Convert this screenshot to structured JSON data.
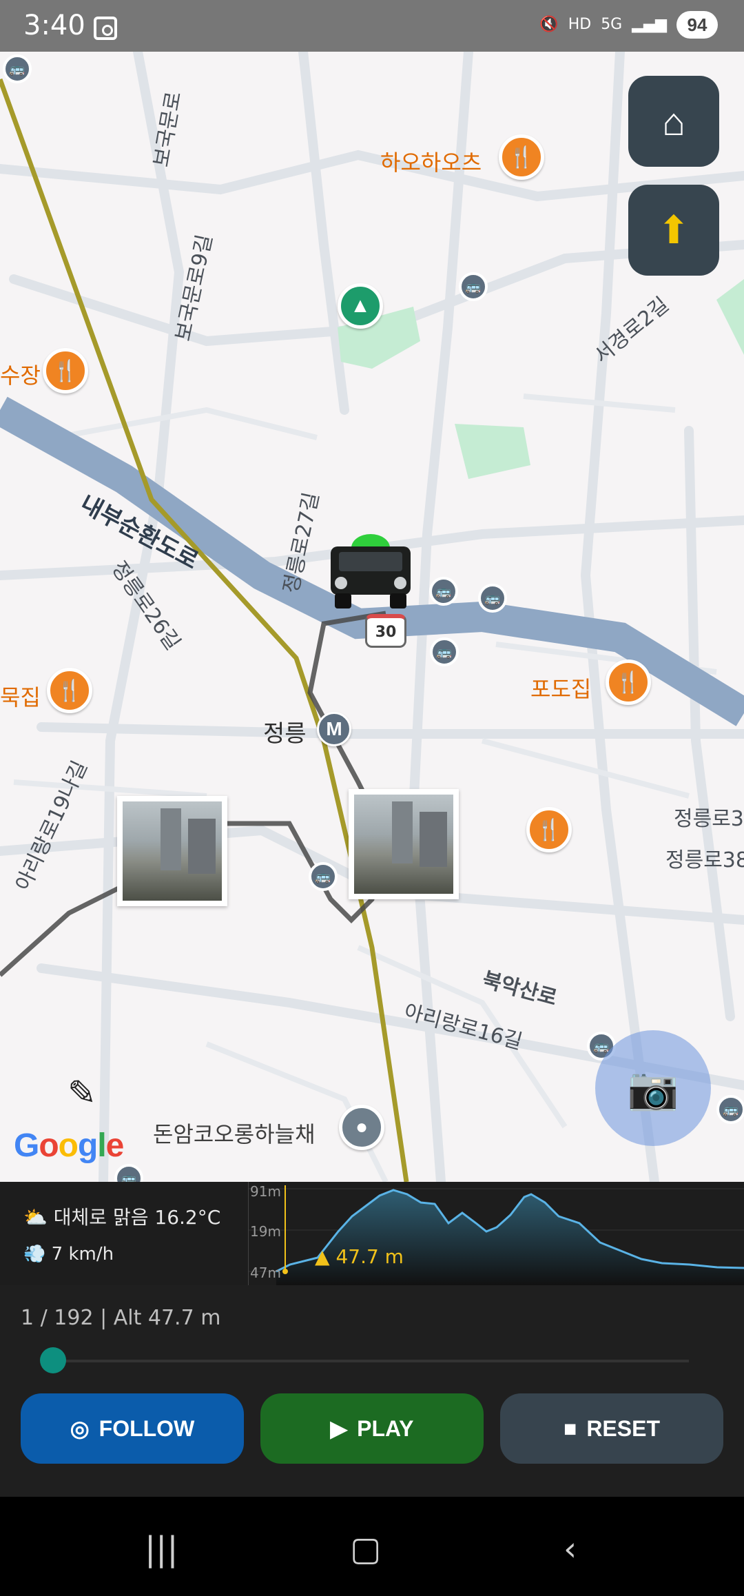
{
  "status": {
    "time": "3:40",
    "battery": "94",
    "icons": [
      "mute-icon",
      "hd-voice-icon",
      "5g-icon",
      "signal-icon"
    ],
    "hd_label": "HD",
    "g_label": "5G"
  },
  "map": {
    "poi_labels": [
      "하오하오츠",
      "수장",
      "포도집",
      "묵집",
      "돈암코오롱하늘채"
    ],
    "road_labels": [
      "내부순환도로",
      "정릉로27길",
      "정릉로26길",
      "서경로2길",
      "보국문로",
      "보국문로9길",
      "아리랑로19나길",
      "북악산로",
      "아리랑로16길",
      "정릉로3",
      "정릉로38"
    ],
    "station_label": "정릉",
    "station_badge": "M",
    "speed_limit": "30",
    "google_logo": "Google",
    "colors": {
      "road_major": "#8fa7c4",
      "route_line": "#a59a2a",
      "poi": "#f08422",
      "park": "#1d9c6b"
    }
  },
  "info": {
    "weather": "대체로 맑음  16.2°C",
    "wind": "7 km/h",
    "chart_axis": [
      "91m",
      "19m",
      "47m"
    ],
    "current_alt": "47.7 m"
  },
  "controls": {
    "progress": "1 / 192  |  Alt 47.7 m",
    "position": 0,
    "total": 192,
    "follow_label": "FOLLOW",
    "play_label": "PLAY",
    "reset_label": "RESET"
  }
}
